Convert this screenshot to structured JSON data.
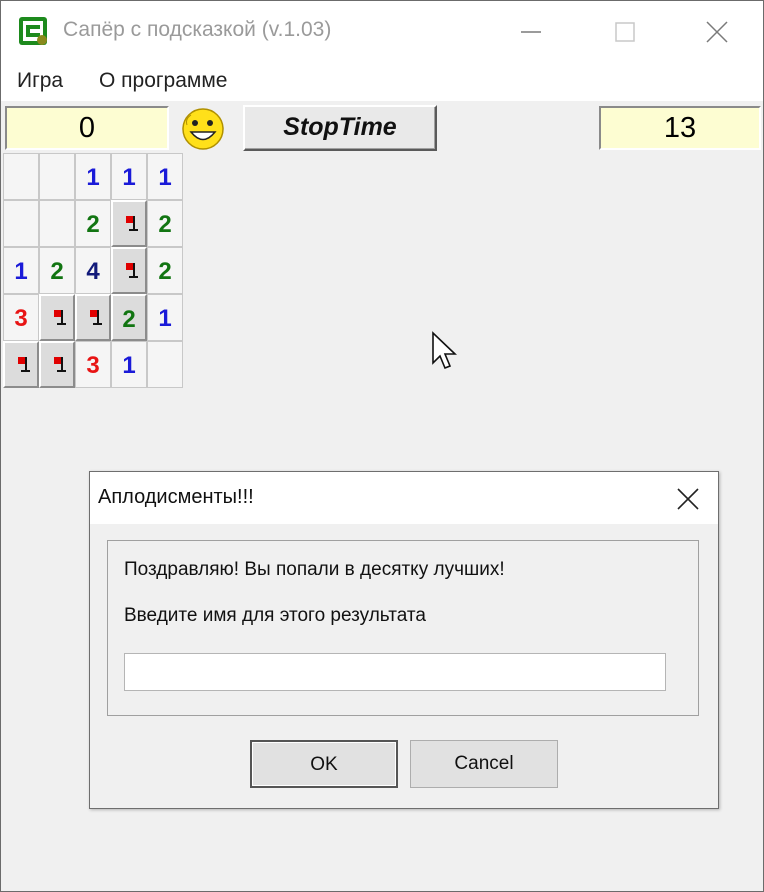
{
  "window": {
    "title": "Сапёр с подсказкой (v.1.03)",
    "icon": "minesweeper-app-icon"
  },
  "menu": {
    "items": [
      "Игра",
      "О программе"
    ]
  },
  "toolbar": {
    "left_counter": "0",
    "smiley": "smiley-face-icon",
    "stop_button": "StopTime",
    "right_counter": "13"
  },
  "board": {
    "rows": [
      [
        "",
        "",
        "1",
        "1",
        "1"
      ],
      [
        "",
        "",
        "2",
        "F",
        "2"
      ],
      [
        "1",
        "2",
        "4",
        "F",
        "2"
      ],
      [
        "3",
        "F",
        "F",
        "2",
        "1"
      ],
      [
        "F",
        "F",
        "3",
        "1",
        ""
      ]
    ],
    "hidden": [
      [
        false,
        false,
        false,
        false,
        false
      ],
      [
        false,
        false,
        false,
        true,
        false
      ],
      [
        false,
        false,
        false,
        true,
        false
      ],
      [
        false,
        true,
        true,
        true,
        false
      ],
      [
        true,
        true,
        false,
        false,
        false
      ]
    ]
  },
  "dialog": {
    "title": "Аплодисменты!!!",
    "message": "Поздравляю! Вы попали в десятку лучших!",
    "prompt": "Введите имя для этого результата",
    "input_value": "",
    "ok_label": "OK",
    "cancel_label": "Cancel"
  },
  "colors": {
    "number_1": "#1a1ad8",
    "number_2": "#127512",
    "number_3": "#e81414",
    "number_4": "#121a7a",
    "flag": "#e00000",
    "counter_bg": "#fdfdd2"
  }
}
